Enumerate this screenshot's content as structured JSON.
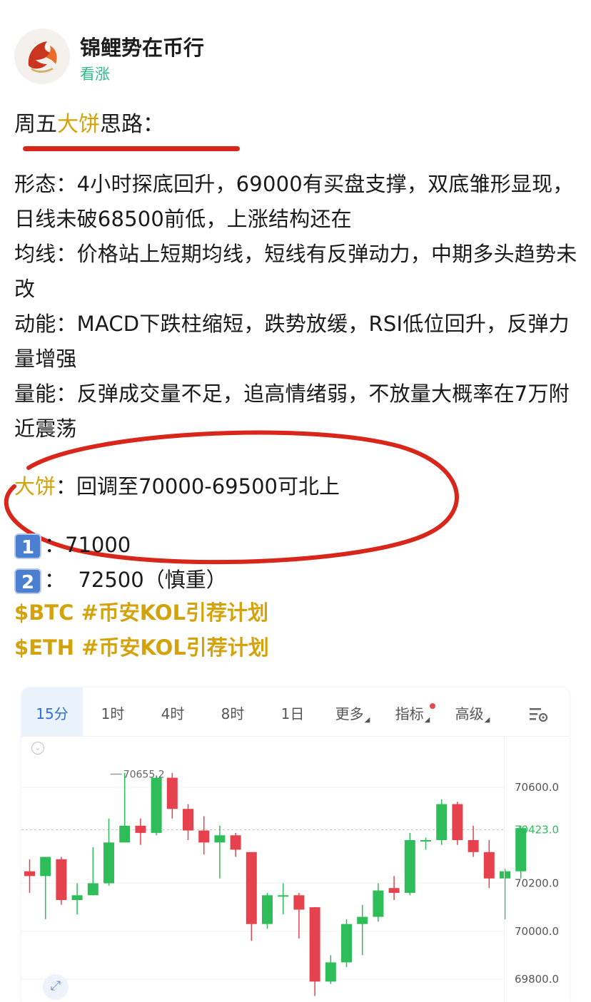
{
  "author": {
    "name": "锦鲤势在币行",
    "sentiment": "看涨"
  },
  "post": {
    "title_prefix": "周五",
    "title_highlight": "大饼",
    "title_suffix": "思路：",
    "paragraphs": [
      "形态：4小时探底回升，69000有买盘支撑，双底雏形显现，日线未破68500前低，上涨结构还在",
      "均线：价格站上短期均线，短线有反弹动力，中期多头趋势未改",
      "动能：MACD下跌柱缩短，跌势放缓，RSI低位回升，反弹力量增强",
      "量能：反弹成交量不足，追高情绪弱，不放量大概率在7万附近震荡"
    ],
    "plan_label": "大饼",
    "plan_text": "：回调至70000-69500可北上",
    "targets": [
      {
        "key": "1",
        "text": "：71000"
      },
      {
        "key": "2",
        "text": "：  72500（慎重）"
      }
    ],
    "tags": [
      "$BTC #币安KOL引荐计划",
      "$ETH #币安KOL引荐计划"
    ]
  },
  "chart": {
    "tabs": [
      "15分",
      "1时",
      "4时",
      "8时",
      "1日",
      "更多",
      "指标",
      "高级"
    ],
    "active_tab": "15分",
    "colors": {
      "up": "#2ebd59",
      "down": "#e6424d",
      "accent": "#d4a20a",
      "link": "#2f6fd6"
    }
  },
  "chart_data": {
    "type": "candlestick",
    "price_ticks": [
      "70600.0",
      "70200.0",
      "70000.0",
      "69800.0"
    ],
    "last_price": "70423.0",
    "high_marker": "70655.2",
    "candles": [
      {
        "o": 70250,
        "h": 70300,
        "l": 70160,
        "c": 70230
      },
      {
        "o": 70230,
        "h": 70260,
        "l": 70050,
        "c": 70310
      },
      {
        "o": 70300,
        "h": 70310,
        "l": 70110,
        "c": 70130
      },
      {
        "o": 70130,
        "h": 70200,
        "l": 70070,
        "c": 70150
      },
      {
        "o": 70150,
        "h": 70350,
        "l": 70150,
        "c": 70200
      },
      {
        "o": 70200,
        "h": 70470,
        "l": 70190,
        "c": 70370
      },
      {
        "o": 70370,
        "h": 70660,
        "l": 70400,
        "c": 70440
      },
      {
        "o": 70440,
        "h": 70470,
        "l": 70360,
        "c": 70410
      },
      {
        "o": 70410,
        "h": 70650,
        "l": 70400,
        "c": 70640
      },
      {
        "o": 70640,
        "h": 70660,
        "l": 70470,
        "c": 70510
      },
      {
        "o": 70510,
        "h": 70530,
        "l": 70380,
        "c": 70420
      },
      {
        "o": 70420,
        "h": 70480,
        "l": 70320,
        "c": 70370
      },
      {
        "o": 70370,
        "h": 70440,
        "l": 70220,
        "c": 70400
      },
      {
        "o": 70400,
        "h": 70410,
        "l": 70310,
        "c": 70340
      },
      {
        "o": 70330,
        "h": 70330,
        "l": 69960,
        "c": 70030
      },
      {
        "o": 70030,
        "h": 70160,
        "l": 70010,
        "c": 70150
      },
      {
        "o": 70150,
        "h": 70200,
        "l": 70070,
        "c": 70150
      },
      {
        "o": 70150,
        "h": 70160,
        "l": 69970,
        "c": 70090
      },
      {
        "o": 70100,
        "h": 70100,
        "l": 69730,
        "c": 69790
      },
      {
        "o": 69790,
        "h": 69900,
        "l": 69780,
        "c": 69870
      },
      {
        "o": 69870,
        "h": 70050,
        "l": 69850,
        "c": 70030
      },
      {
        "o": 70030,
        "h": 70110,
        "l": 69900,
        "c": 70060
      },
      {
        "o": 70060,
        "h": 70200,
        "l": 70040,
        "c": 70170
      },
      {
        "o": 70180,
        "h": 70230,
        "l": 70130,
        "c": 70160
      },
      {
        "o": 70160,
        "h": 70410,
        "l": 70150,
        "c": 70380
      },
      {
        "o": 70380,
        "h": 70390,
        "l": 70340,
        "c": 70380
      },
      {
        "o": 70380,
        "h": 70550,
        "l": 70360,
        "c": 70530
      },
      {
        "o": 70530,
        "h": 70540,
        "l": 70360,
        "c": 70380
      },
      {
        "o": 70380,
        "h": 70440,
        "l": 70310,
        "c": 70330
      },
      {
        "o": 70330,
        "h": 70380,
        "l": 70180,
        "c": 70220
      },
      {
        "o": 70220,
        "h": 70260,
        "l": 70050,
        "c": 70250
      },
      {
        "o": 70250,
        "h": 70440,
        "l": 70220,
        "c": 70430
      }
    ]
  }
}
